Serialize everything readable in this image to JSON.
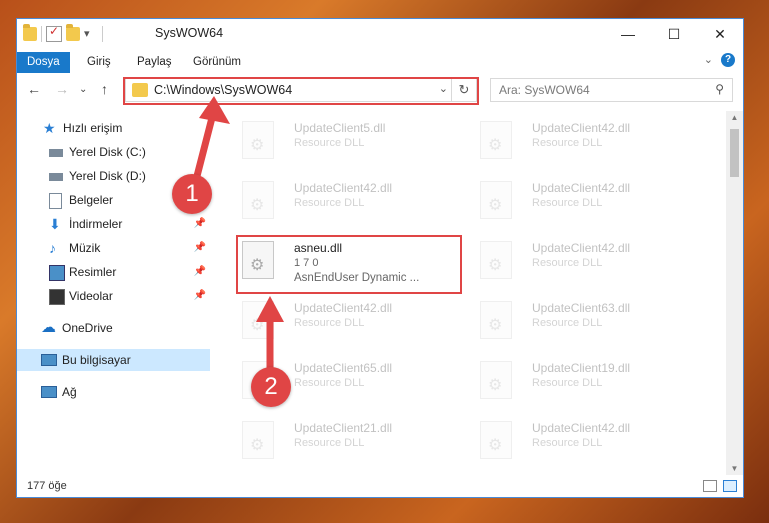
{
  "window": {
    "title": "SysWOW64"
  },
  "ribbon": {
    "tabs": [
      "Dosya",
      "Giriş",
      "Paylaş",
      "Görünüm"
    ]
  },
  "navbar": {
    "address": "C:\\Windows\\SysWOW64",
    "search_placeholder": "Ara: SysWOW64"
  },
  "sidebar": {
    "items": [
      {
        "label": "Hızlı erişim",
        "icon": "star-icon"
      },
      {
        "label": "Yerel Disk (C:)",
        "icon": "drive-icon"
      },
      {
        "label": "Yerel Disk (D:)",
        "icon": "drive-icon"
      },
      {
        "label": "Belgeler",
        "icon": "documents-icon"
      },
      {
        "label": "İndirmeler",
        "icon": "download-icon"
      },
      {
        "label": "Müzik",
        "icon": "music-icon"
      },
      {
        "label": "Resimler",
        "icon": "pictures-icon"
      },
      {
        "label": "Videolar",
        "icon": "videos-icon"
      },
      {
        "label": "OneDrive",
        "icon": "cloud-icon"
      },
      {
        "label": "Bu bilgisayar",
        "icon": "computer-icon"
      },
      {
        "label": "Ağ",
        "icon": "network-icon"
      }
    ]
  },
  "files": {
    "left": [
      {
        "name": "UpdateClient5.dll",
        "type": "Resource DLL"
      },
      {
        "name": "UpdateClient42.dll",
        "type": "Resource DLL"
      },
      {
        "name": "asneu.dll",
        "version": "1 7 0",
        "desc": "AsnEndUser Dynamic ..."
      },
      {
        "name": "UpdateClient42.dll",
        "type": "Resource DLL"
      },
      {
        "name": "UpdateClient65.dll",
        "type": "Resource DLL"
      },
      {
        "name": "UpdateClient21.dll",
        "type": "Resource DLL"
      }
    ],
    "right": [
      {
        "name": "UpdateClient42.dll",
        "type": "Resource DLL"
      },
      {
        "name": "UpdateClient42.dll",
        "type": "Resource DLL"
      },
      {
        "name": "UpdateClient42.dll",
        "type": "Resource DLL"
      },
      {
        "name": "UpdateClient63.dll",
        "type": "Resource DLL"
      },
      {
        "name": "UpdateClient19.dll",
        "type": "Resource DLL"
      },
      {
        "name": "UpdateClient42.dll",
        "type": "Resource DLL"
      }
    ]
  },
  "status": {
    "count": "177 öğe"
  },
  "annotations": {
    "step1": "1",
    "step2": "2"
  },
  "colors": {
    "accent": "#1979ca",
    "highlight": "#e04545"
  }
}
